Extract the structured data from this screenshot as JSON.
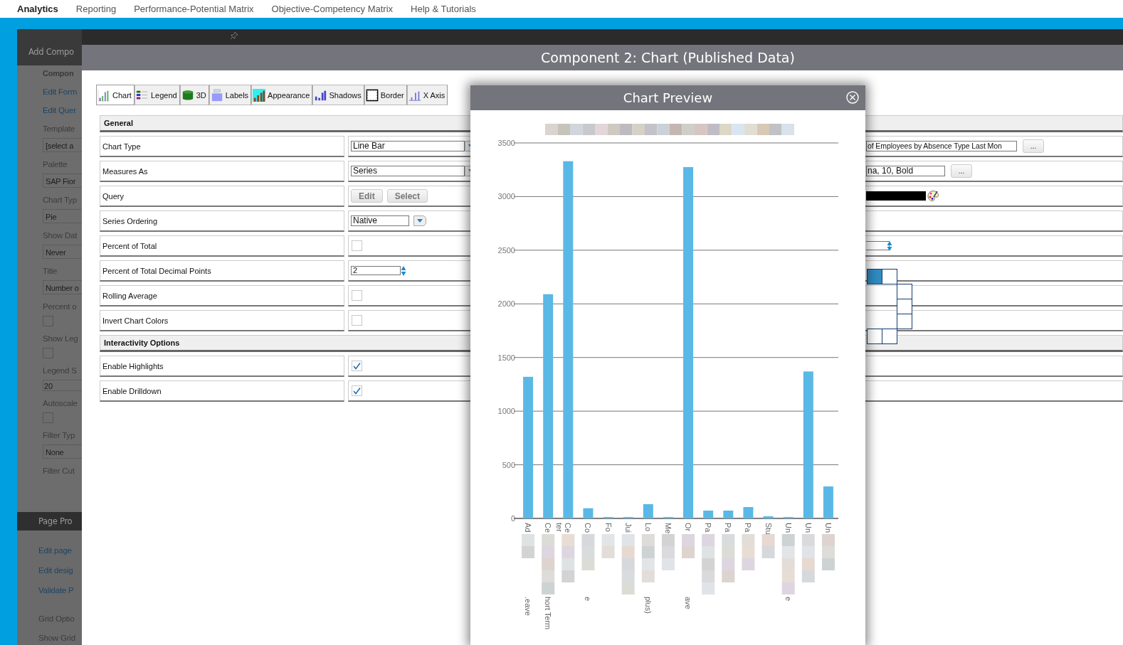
{
  "nav": [
    {
      "label": "Analytics",
      "selected": true
    },
    {
      "label": "Reporting",
      "selected": false
    },
    {
      "label": "Performance-Potential Matrix",
      "selected": false
    },
    {
      "label": "Objective-Competency Matrix",
      "selected": false
    },
    {
      "label": "Help & Tutorials",
      "selected": false
    }
  ],
  "side_panel": {
    "title": "Add Compo",
    "items": [
      {
        "kind": "heading",
        "text": "Compon"
      },
      {
        "kind": "link",
        "text": "Edit Form"
      },
      {
        "kind": "link",
        "text": "Edit Quer"
      },
      {
        "kind": "label",
        "text": "Template"
      },
      {
        "kind": "field",
        "text": "[select a"
      },
      {
        "kind": "label",
        "text": "Palette"
      },
      {
        "kind": "field",
        "text": "SAP Fior"
      },
      {
        "kind": "label",
        "text": "Chart Typ"
      },
      {
        "kind": "field",
        "text": "Pie"
      },
      {
        "kind": "label",
        "text": "Show Dat"
      },
      {
        "kind": "field",
        "text": "Never"
      },
      {
        "kind": "label",
        "text": "Title"
      },
      {
        "kind": "field",
        "text": "Number o"
      },
      {
        "kind": "label",
        "text": "Percent o"
      },
      {
        "kind": "checkbox",
        "checked": false
      },
      {
        "kind": "label",
        "text": "Show Leg"
      },
      {
        "kind": "checkbox",
        "checked": false
      },
      {
        "kind": "label",
        "text": "Legend S"
      },
      {
        "kind": "number",
        "text": "20"
      },
      {
        "kind": "label",
        "text": "Autoscale"
      },
      {
        "kind": "checkbox",
        "checked": false
      },
      {
        "kind": "label",
        "text": "Filter Typ"
      },
      {
        "kind": "field",
        "text": "None"
      },
      {
        "kind": "label",
        "text": "Filter Cut"
      }
    ]
  },
  "page_panel": {
    "title": "Page Pro",
    "items": [
      {
        "kind": "link",
        "text": "Edit page"
      },
      {
        "kind": "link",
        "text": "Edit desig"
      },
      {
        "kind": "link",
        "text": "Validate P"
      },
      {
        "kind": "label",
        "text": "Grid Optio"
      },
      {
        "kind": "label",
        "text": "Show Grid"
      }
    ]
  },
  "dialog": {
    "title": "Component 2: Chart (Published Data)",
    "tabs": [
      {
        "label": "Chart",
        "selected": true
      },
      {
        "label": "Legend",
        "selected": false
      },
      {
        "label": "3D",
        "selected": false
      },
      {
        "label": "Labels",
        "selected": false
      },
      {
        "label": "Appearance",
        "selected": false
      },
      {
        "label": "Shadows",
        "selected": false
      },
      {
        "label": "Border",
        "selected": false
      },
      {
        "label": "X Axis",
        "selected": false
      }
    ],
    "sections": [
      {
        "title": "General",
        "rows": [
          {
            "label": "Chart Type",
            "kind": "select",
            "value": "Line Bar",
            "far": {
              "kind": "field_button",
              "value": "of Employees by Absence Type Last Mon",
              "button": "..."
            }
          },
          {
            "label": "Measures As",
            "kind": "select",
            "value": "Series",
            "far": {
              "kind": "field_button",
              "value": "na, 10, Bold",
              "button": "..."
            }
          },
          {
            "label": "Query",
            "kind": "buttons",
            "buttons": [
              "Edit",
              "Select"
            ],
            "far": {
              "kind": "color"
            }
          },
          {
            "label": "Series Ordering",
            "kind": "small_select",
            "value": "Native"
          },
          {
            "label": "Percent of Total",
            "kind": "checkbox",
            "checked": false,
            "far": {
              "kind": "spinner"
            }
          },
          {
            "label": "Percent of Total Decimal Points",
            "kind": "spinner",
            "value": "2",
            "far": {
              "kind": "grid"
            }
          },
          {
            "label": "Rolling Average",
            "kind": "checkbox",
            "checked": false
          },
          {
            "label": "Invert Chart Colors",
            "kind": "checkbox",
            "checked": false
          }
        ]
      },
      {
        "title": "Interactivity Options",
        "rows": [
          {
            "label": "Enable Highlights",
            "kind": "checkbox",
            "checked": true
          },
          {
            "label": "Enable Drilldown",
            "kind": "checkbox",
            "checked": true
          }
        ]
      }
    ]
  },
  "chart_preview": {
    "title": "Chart Preview",
    "chart_data": {
      "type": "bar",
      "grid": true,
      "categories": [
        "Ad",
        "Ce",
        "Ce",
        "Co",
        "Fo",
        "Jui",
        "Lo",
        "Me",
        "Or",
        "Pa",
        "Pa",
        "Pa",
        "Stu",
        "Un",
        "Un",
        "Un"
      ],
      "series": [
        {
          "color": "#5ab8e6",
          "values": [
            1320,
            2090,
            3330,
            95,
            13,
            13,
            133,
            13,
            3275,
            73,
            73,
            106,
            20,
            13,
            1370,
            298
          ]
        }
      ],
      "ylim": [
        0,
        3500
      ],
      "yticks": [
        0,
        500,
        1000,
        1500,
        2000,
        2500,
        3000,
        3500
      ]
    },
    "label_extras": [
      {
        "kind": "tail",
        "text": ".eave"
      },
      {
        "kind": "tail",
        "text": "hort Term"
      },
      {
        "kind": "second_line",
        "text": "ter"
      },
      {
        "kind": "tail",
        "text": "e"
      },
      {
        "kind": "none"
      },
      {
        "kind": "none"
      },
      {
        "kind": "tail",
        "text": "plus)"
      },
      {
        "kind": "none"
      },
      {
        "kind": "tail",
        "text": "ave"
      },
      {
        "kind": "none"
      },
      {
        "kind": "none"
      },
      {
        "kind": "none"
      },
      {
        "kind": "none"
      },
      {
        "kind": "tail",
        "text": "e"
      },
      {
        "kind": "none"
      },
      {
        "kind": "none"
      }
    ]
  }
}
